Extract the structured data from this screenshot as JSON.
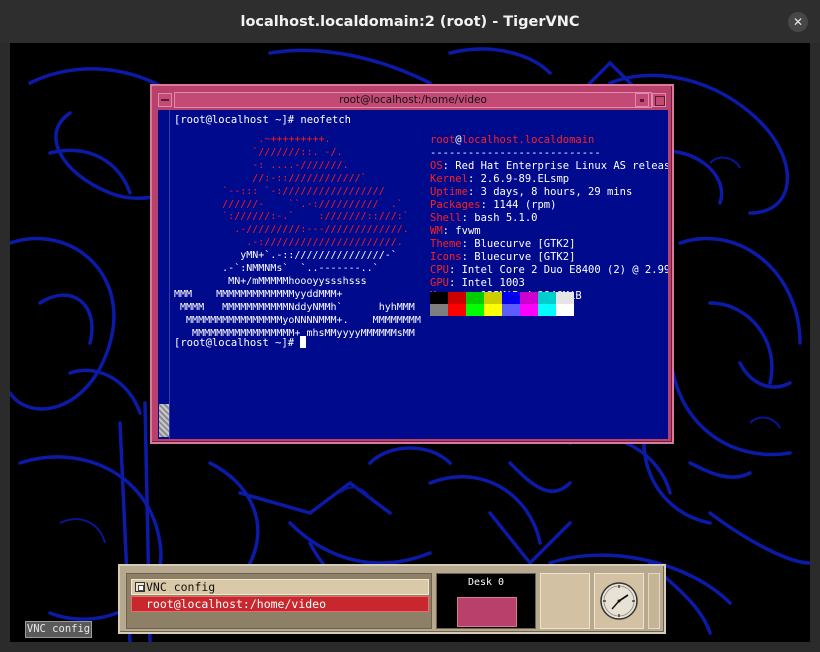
{
  "window": {
    "title": "localhost.localdomain:2 (root) - TigerVNC",
    "close_glyph": "✕"
  },
  "xterm": {
    "title": "root@localhost:/home/video",
    "prompt_command": "[root@localhost ~]# neofetch",
    "prompt_end": "[root@localhost ~]# ",
    "info": {
      "user": "root",
      "at": "@",
      "host": "localhost.localdomain",
      "separator": "---------------------------",
      "rows": [
        {
          "key": "OS",
          "value": ": Red Hat Enterprise Linux AS releas"
        },
        {
          "key": "Kernel",
          "value": ": 2.6.9-89.ELsmp"
        },
        {
          "key": "Uptime",
          "value": ": 3 days, 8 hours, 29 mins"
        },
        {
          "key": "Packages",
          "value": ": 1144 (rpm)"
        },
        {
          "key": "Shell",
          "value": ": bash 5.1.0"
        },
        {
          "key": "WM",
          "value": ": fvwm"
        },
        {
          "key": "Theme",
          "value": ": Bluecurve [GTK2]"
        },
        {
          "key": "Icons",
          "value": ": Bluecurve [GTK2]"
        },
        {
          "key": "CPU",
          "value": ": Intel Core 2 Duo E8400 (2) @ 2.99"
        },
        {
          "key": "GPU",
          "value": ": Intel 1003"
        },
        {
          "key": "Memory",
          "value": ": 135MiB / 3846MiB"
        }
      ]
    },
    "swatches_top": [
      "#000000",
      "#cd0000",
      "#00cd00",
      "#cdcd00",
      "#0000ee",
      "#cd00cd",
      "#00cdcd",
      "#e5e5e5"
    ],
    "swatches_bottom": [
      "#7f7f7f",
      "#ff0000",
      "#00ff00",
      "#ffff00",
      "#5c5cff",
      "#ff00ff",
      "#00ffff",
      "#ffffff"
    ],
    "logo_lines": [
      "              .~+++++++++.",
      "             `///////::. -/.",
      "             -: ....-///////.",
      "             //:-::////////////`",
      "        `--::: `-://///////////////",
      "        //////-    ``.-://////////  .`",
      "        `://////:-.`    :///////::///:`",
      "          .-/////////:---/////////////.",
      "            .-://////////////////////.",
      "           yMN+`.-::///////////////-`",
      "        .-`:NMMNMs`  `..-------..`",
      "         MN+/mMMMMMhoooyyssshsss",
      "MMM    MMMMMMMMMMMMMyyddMMM+",
      " MMMM   MMMMMMMMMMMNddyNMMh`      hyhMMM",
      "  MMMMMMMMMMMMMMMMyoNNNNMMM+.    MMMMMMMM",
      "   MMMMMMMMMMMMMMMMM+ mhsMMyyyyMMMMMMsMM"
    ]
  },
  "panel": {
    "vnc_item": "VNC config",
    "term_item": "root@localhost:/home/video",
    "pager_label": "Desk 0"
  },
  "desktop_icon_label": "VNC config"
}
